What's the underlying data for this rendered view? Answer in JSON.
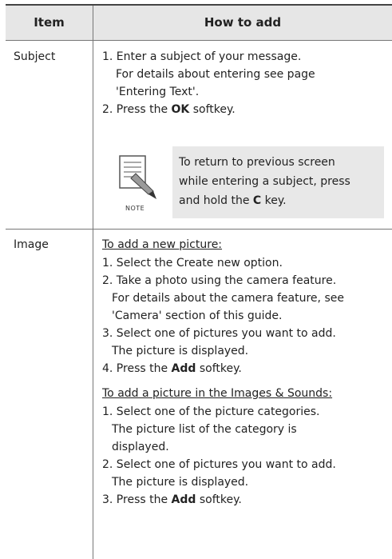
{
  "table": {
    "headers": {
      "item": "Item",
      "how": "How to add"
    },
    "rows": [
      {
        "item": "Subject",
        "lines": [
          [
            "1. Enter a subject of your message."
          ],
          [
            "For details about entering see page"
          ],
          [
            "'Entering Text'."
          ],
          [
            "2. Press the ",
            "OK",
            " softkey."
          ]
        ],
        "note": {
          "label": "NOTE",
          "lines": [
            [
              "To return to previous screen"
            ],
            [
              "while entering a subject, press"
            ],
            [
              "and hold the ",
              "C",
              " key."
            ]
          ]
        }
      },
      {
        "item": "Image",
        "sections": [
          {
            "heading": "To add a new picture:",
            "lines": [
              [
                "1. Select the Create new option."
              ],
              [
                "2. Take a photo using the camera feature."
              ],
              [
                "For details about the camera feature, see"
              ],
              [
                "'Camera' section of this guide."
              ],
              [
                "3. Select one of pictures you want to add."
              ],
              [
                "The picture is displayed."
              ],
              [
                "4. Press the ",
                "Add",
                " softkey."
              ]
            ]
          },
          {
            "heading": "To add a picture in the Images & Sounds:",
            "lines": [
              [
                "1. Select one of the picture categories."
              ],
              [
                "The picture list of the category is"
              ],
              [
                "displayed."
              ],
              [
                "2. Select one of pictures you want to add."
              ],
              [
                "The picture is displayed."
              ],
              [
                "3. Press the ",
                "Add",
                " softkey."
              ]
            ]
          }
        ]
      }
    ]
  }
}
